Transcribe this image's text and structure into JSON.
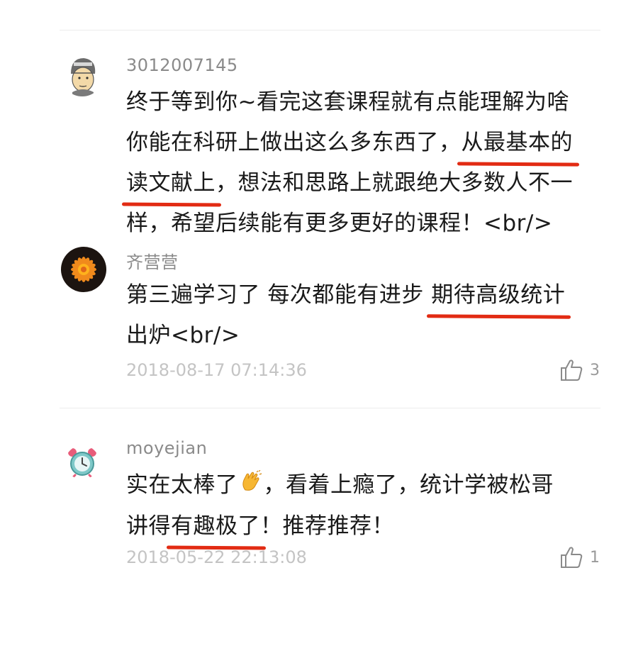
{
  "comments": [
    {
      "username": "3012007145",
      "lines": [
        [
          "终于等到你~看完这套课程就有点能理解为啥"
        ],
        [
          "你能在科研上做出这么多东西了，",
          "从最基本的"
        ],
        [
          "读文献上",
          "，想法和思路上就跟绝大多数人不一"
        ],
        [
          "样，希望后续能有更多更好的课程！<br/>"
        ]
      ]
    },
    {
      "username": "齐营营",
      "lines": [
        [
          "第三遍学习了 每次都能有进步 ",
          "期待高级统计"
        ],
        [
          "出炉<br/>"
        ]
      ],
      "timestamp": "2018-08-17 07:14:36",
      "likes": "3"
    },
    {
      "username": "moyejian",
      "line1_before": "实在太棒了",
      "line1_after": "，看着上瘾了，统计学被松哥",
      "line2_before": "讲得",
      "line2_highlight": "有趣极了",
      "line2_after": "！推荐推荐！",
      "timestamp": "2018-05-22 22:13:08",
      "likes": "1"
    }
  ],
  "icons": {
    "like": "thumbs-up-icon",
    "emoji": "clapping-hands-icon"
  },
  "colors": {
    "highlight": "#e22b13",
    "timestamp": "#c4c4c4",
    "username": "#8a8a8a"
  }
}
